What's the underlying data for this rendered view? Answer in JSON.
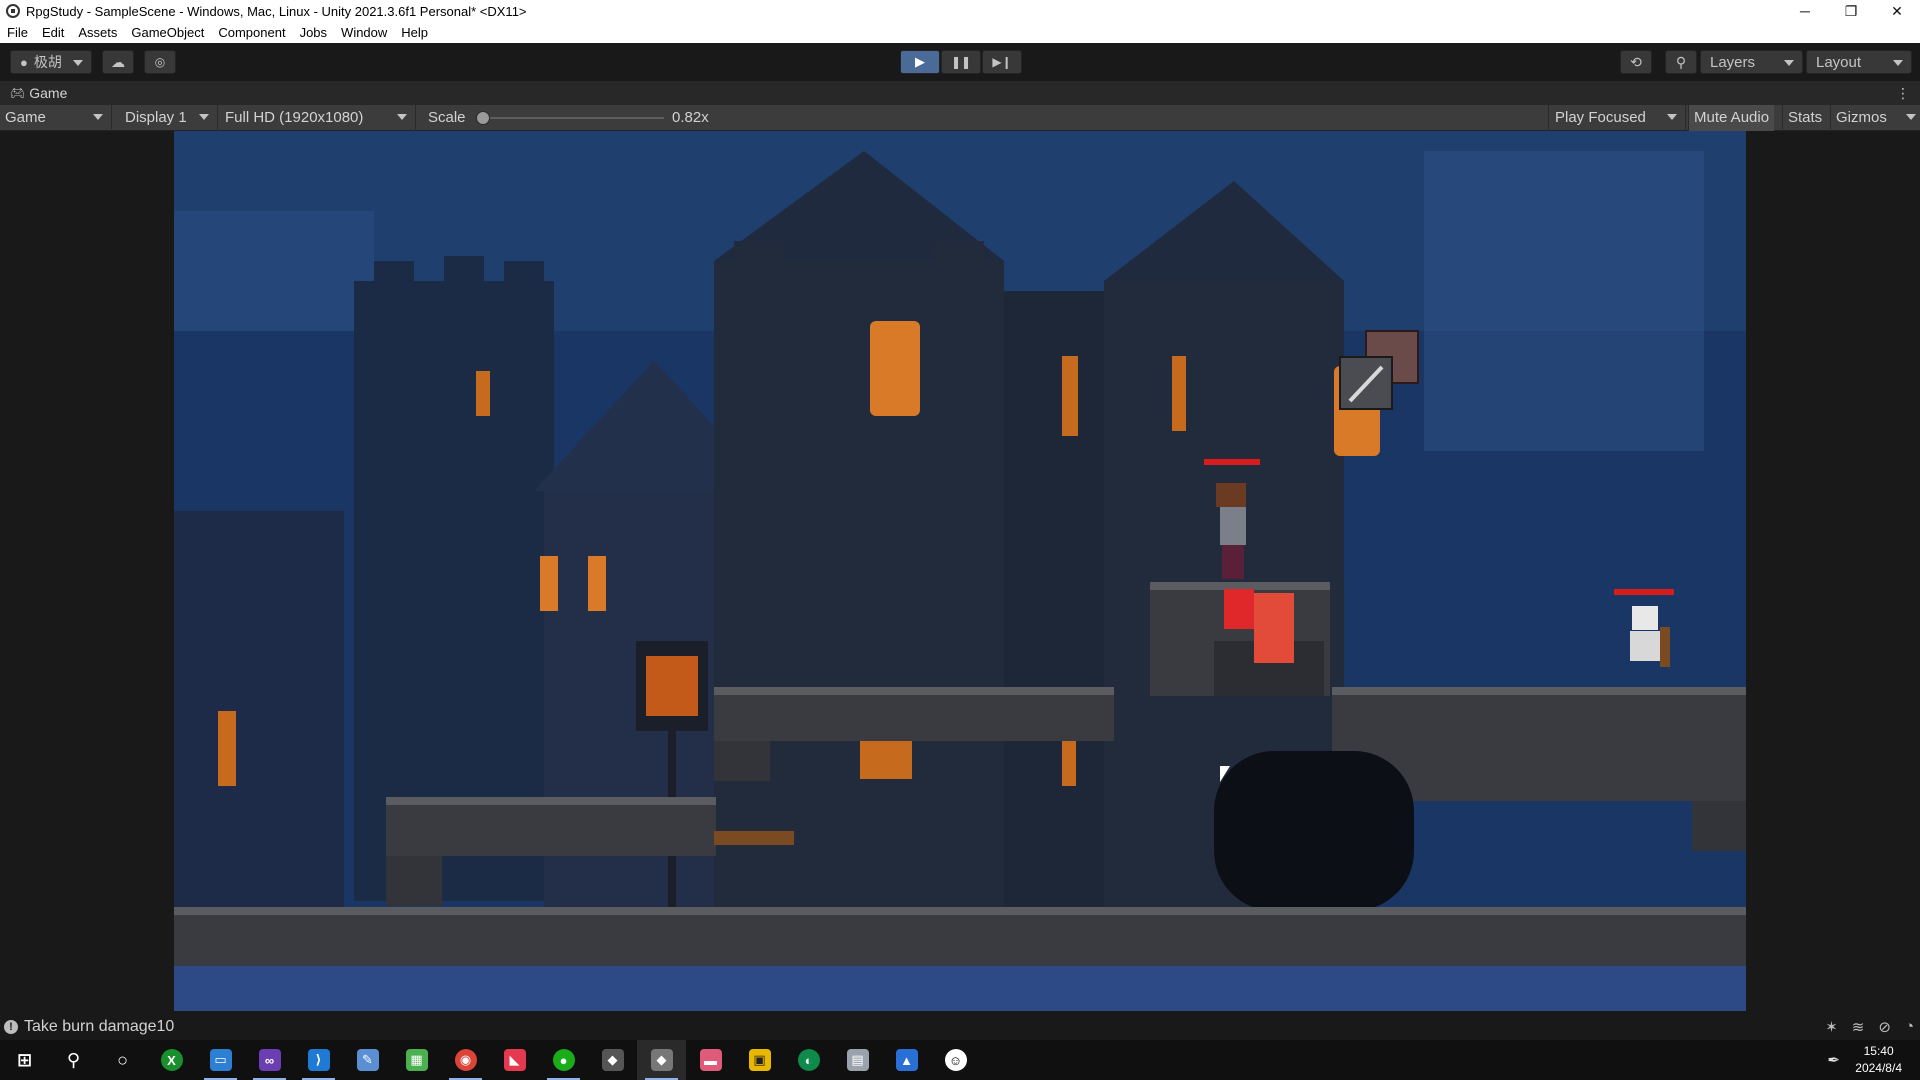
{
  "window": {
    "title": "RpgStudy - SampleScene - Windows, Mac, Linux - Unity 2021.3.6f1 Personal* <DX11>"
  },
  "menu": [
    "File",
    "Edit",
    "Assets",
    "GameObject",
    "Component",
    "Jobs",
    "Window",
    "Help"
  ],
  "toolbar": {
    "account_label": "极胡",
    "layers_label": "Layers",
    "layout_label": "Layout"
  },
  "game_tab": {
    "label": "Game"
  },
  "game_toolbar": {
    "view_mode": "Game",
    "display": "Display 1",
    "resolution": "Full HD (1920x1080)",
    "scale_label": "Scale",
    "scale_value": "0.82x",
    "scale_fraction": 0.02,
    "play_mode": "Play Focused",
    "mute_audio": "Mute Audio",
    "stats": "Stats",
    "gizmos": "Gizmos"
  },
  "status": {
    "message": "Take burn damage10"
  },
  "taskbar": {
    "time": "15:40",
    "date": "2024/8/4",
    "apps": [
      {
        "name": "start-menu-icon",
        "glyph": "⊞",
        "color": "transparent"
      },
      {
        "name": "search-icon",
        "glyph": "⚲",
        "color": "transparent"
      },
      {
        "name": "task-view-icon",
        "glyph": "○",
        "color": "transparent"
      },
      {
        "name": "xbox-app-icon",
        "glyph": "X",
        "color": "#1a8f2e"
      },
      {
        "name": "file-explorer-icon",
        "glyph": "▭",
        "color": "#2d7fd3"
      },
      {
        "name": "visual-studio-icon",
        "glyph": "∞",
        "color": "#6b3fb3"
      },
      {
        "name": "vscode-icon",
        "glyph": "⟩",
        "color": "#1f7ad4"
      },
      {
        "name": "notepad-app-icon",
        "glyph": "✎",
        "color": "#5a8fd4"
      },
      {
        "name": "spreadsheet-app-icon",
        "glyph": "▦",
        "color": "#4caf50"
      },
      {
        "name": "chrome-icon",
        "glyph": "◉",
        "color": "#db4437"
      },
      {
        "name": "red-app-icon",
        "glyph": "◣",
        "color": "#e53950"
      },
      {
        "name": "wechat-icon",
        "glyph": "●",
        "color": "#1aad19"
      },
      {
        "name": "unity-hub-icon",
        "glyph": "◆",
        "color": "#555555"
      },
      {
        "name": "unity-editor-icon",
        "glyph": "◆",
        "color": "#777777"
      },
      {
        "name": "media-app-icon",
        "glyph": "▬",
        "color": "#e05a7a"
      },
      {
        "name": "yellow-app-icon",
        "glyph": "▣",
        "color": "#e8b800"
      },
      {
        "name": "green-app-icon",
        "glyph": "◐",
        "color": "#0e8a4a"
      },
      {
        "name": "dialog-app-icon",
        "glyph": "▤",
        "color": "#9aa3ad"
      },
      {
        "name": "blue-chat-icon",
        "glyph": "▲",
        "color": "#2a6fd6"
      },
      {
        "name": "qq-icon",
        "glyph": "☺",
        "color": "#000000"
      }
    ]
  }
}
